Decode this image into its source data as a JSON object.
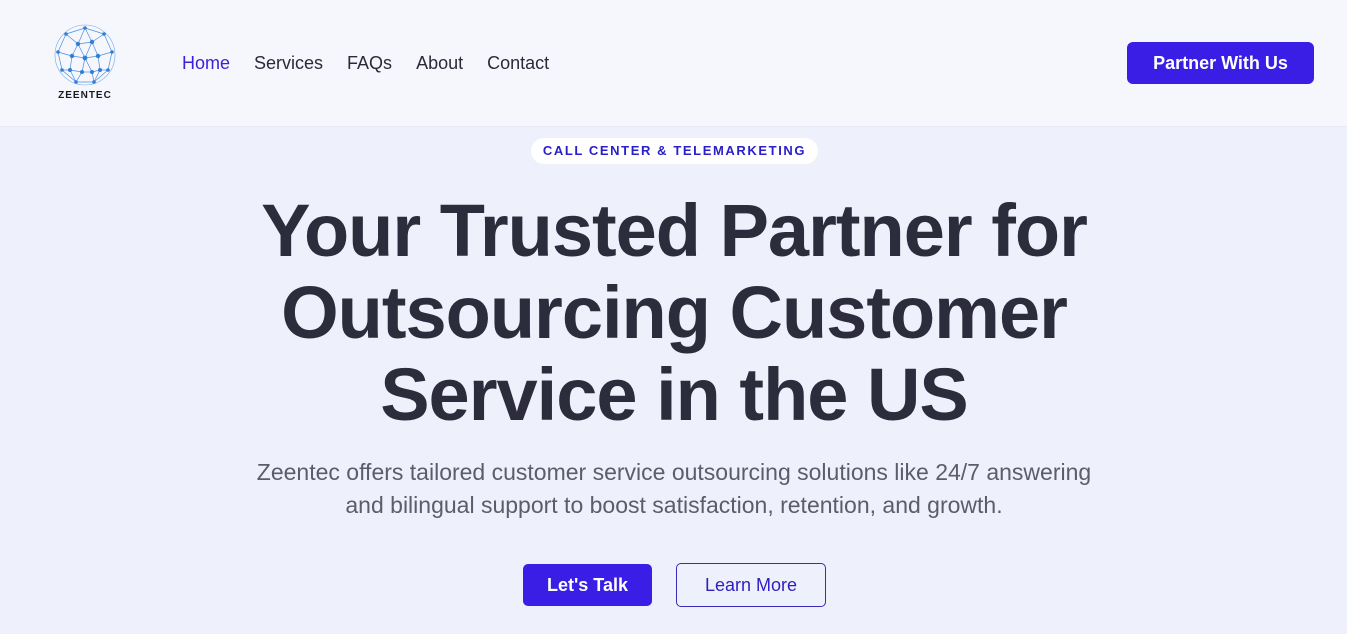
{
  "brand": {
    "name": "ZEENTEC",
    "logo_icon": "network-globe-icon",
    "accent_color": "#3a1ee6"
  },
  "nav": {
    "items": [
      {
        "label": "Home",
        "active": true
      },
      {
        "label": "Services",
        "active": false
      },
      {
        "label": "FAQs",
        "active": false
      },
      {
        "label": "About",
        "active": false
      },
      {
        "label": "Contact",
        "active": false
      }
    ],
    "cta_label": "Partner With Us"
  },
  "hero": {
    "badge": "CALL CENTER & TELEMARKETING",
    "title_lines": [
      "Your Trusted Partner for",
      "Outsourcing Customer",
      "Service in the US"
    ],
    "subtitle_lines": [
      "Zeentec offers tailored customer service outsourcing solutions like 24/7 answering",
      "and bilingual support to boost satisfaction, retention, and growth."
    ],
    "primary_button": "Let's Talk",
    "secondary_button": "Learn More"
  }
}
